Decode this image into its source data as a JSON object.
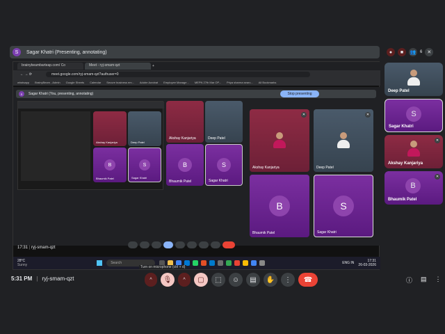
{
  "header": {
    "avatar_letter": "S",
    "title": "Sagar Khatri (Presenting, annotating)",
    "participant_count": "6"
  },
  "presented": {
    "tabs": [
      "brainybeambarteap.com/ Co",
      "Meet - ryj-smam-qzt"
    ],
    "url": "meet.google.com/ryj-smam-qzt?authuser=0",
    "bookmarks": [
      "whatsapp",
      "BrainyBeam - Admin",
      "Google Sheets",
      "Calendar",
      "Secure business em...",
      "Adobe Acrobat",
      "Employee Manage...",
      "MEPN 27th Mar OP...",
      "Priya sharma searc...",
      "All Bookmarks"
    ],
    "inner_title": "Sagar Khatri (You, presenting, annotating)",
    "stop_label": "Stop presenting",
    "nested_tiles": [
      {
        "name": "Akshay Kanjariya"
      },
      {
        "name": "Deep Patel"
      },
      {
        "name": "Bhaumik Patel",
        "letter": "B"
      },
      {
        "name": "Sagar Khatri",
        "letter": "S"
      }
    ],
    "meeting_time": "17:31",
    "meeting_code": "ryj-smam-qzt",
    "taskbar": {
      "weather": "28°C",
      "weather_sub": "Sunny",
      "search": "Search",
      "lang": "ENG IN",
      "clock": "17:31",
      "date": "26-03-2026"
    },
    "big_tiles": [
      {
        "name": "Akshay Kanjariya"
      },
      {
        "name": "Deep Patel"
      },
      {
        "name": "Bhaumik Patel",
        "letter": "B"
      },
      {
        "name": "Sagar Khatri",
        "letter": "S"
      }
    ]
  },
  "sidebar": [
    {
      "name": "Deep Patel"
    },
    {
      "name": "Sagar Khatri",
      "letter": "S"
    },
    {
      "name": "Akshay Kanjariya"
    },
    {
      "name": "Bhaumik Patel",
      "letter": "B"
    }
  ],
  "bottom": {
    "time": "5:31 PM",
    "code": "ryj-smam-qzt",
    "tooltip": "Turn on microphone (ctrl + d)"
  },
  "colors": {
    "hangup": "#ea4335",
    "presenting_purple": "#7b2fa0",
    "stop_button": "#8ab4f8"
  }
}
